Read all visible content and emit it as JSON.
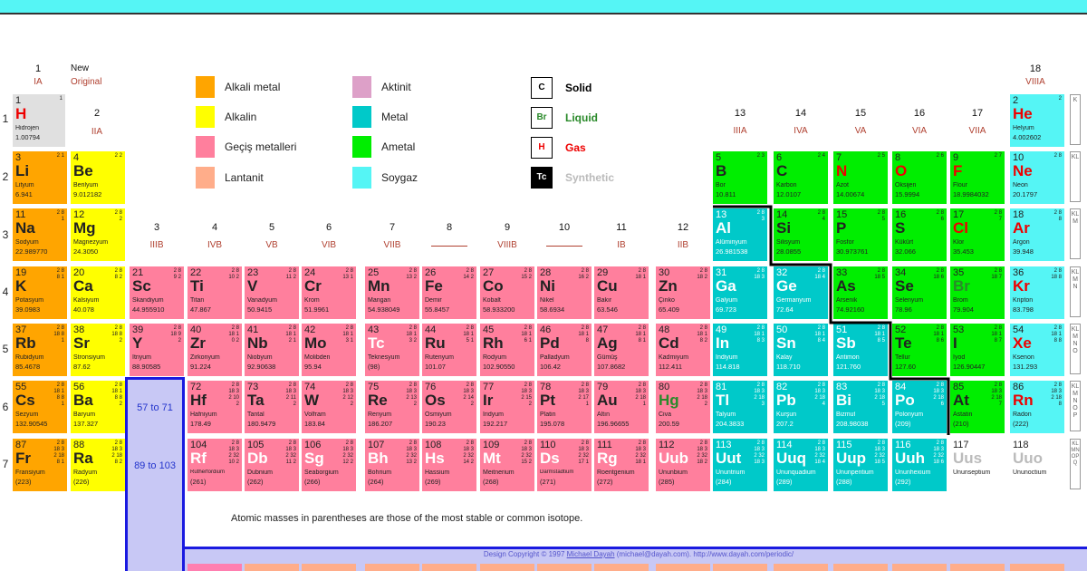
{
  "colors": {
    "alkali": "#ffa500",
    "alkaline": "#ffff00",
    "transition": "#ff7f9d",
    "lanthanide": "#ffad8a",
    "actinide": "#dda0c8",
    "metal": "#00c9c9",
    "nonmetal": "#00ee00",
    "noble": "#55f5f5",
    "unknown": "#ffffff",
    "hydrogen": "#e0e0e0"
  },
  "header": {
    "g1": "1",
    "ia": "IA",
    "new": "New",
    "original": "Original",
    "g2": "2",
    "iia": "IIA",
    "g18": "18",
    "viiia": "VIIIA"
  },
  "groups": [
    {
      "num": "3",
      "rom": "IIIB"
    },
    {
      "num": "4",
      "rom": "IVB"
    },
    {
      "num": "5",
      "rom": "VB"
    },
    {
      "num": "6",
      "rom": "VIB"
    },
    {
      "num": "7",
      "rom": "VIIB"
    },
    {
      "num": "8",
      "rom": ""
    },
    {
      "num": "9",
      "rom": "VIIIB"
    },
    {
      "num": "10",
      "rom": ""
    },
    {
      "num": "11",
      "rom": "IB"
    },
    {
      "num": "12",
      "rom": "IIB"
    },
    {
      "num": "13",
      "rom": "IIIA"
    },
    {
      "num": "14",
      "rom": "IVA"
    },
    {
      "num": "15",
      "rom": "VA"
    },
    {
      "num": "16",
      "rom": "VIA"
    },
    {
      "num": "17",
      "rom": "VIIA"
    }
  ],
  "legend": {
    "alkali": "Alkali metal",
    "alkaline": "Alkalin",
    "transition": "Geçiş metalleri",
    "lanthanide": "Lantanit",
    "actinide": "Aktinit",
    "metal": "Metal",
    "nonmetal": "Ametal",
    "noble": "Soygaz"
  },
  "states": {
    "solid_box": "C",
    "solid": "Solid",
    "liquid_box": "Br",
    "liquid": "Liquid",
    "gas_box": "H",
    "gas": "Gas",
    "syn_box": "Tc",
    "syn": "Synthetic"
  },
  "rows": [
    "1",
    "2",
    "3",
    "4",
    "5",
    "6",
    "7"
  ],
  "shells": [
    "K",
    "KL",
    "KLM",
    "KLMN",
    "KLMNO",
    "KLMNOP",
    "KLMNOPQ"
  ],
  "placeholders": {
    "lan": "57 to 71",
    "act": "89 to 103"
  },
  "footnote": "Atomic masses in parentheses are those of the most stable or common isotope.",
  "copyright_pre": "Design Copyright © 1997 ",
  "copyright_name": "Michael Dayah",
  "copyright_post": " (michael@dayah.com). http://www.dayah.com/periodic/",
  "elements": [
    {
      "z": "1",
      "s": "H",
      "n": "Hidrojen",
      "m": "1.00794",
      "sh": "1",
      "c": "hydrogen",
      "col": 1,
      "row": 1,
      "st": "gas"
    },
    {
      "z": "2",
      "s": "He",
      "n": "Helyum",
      "m": "4.002602",
      "sh": "2",
      "c": "noble",
      "col": 18,
      "row": 1,
      "st": "gas"
    },
    {
      "z": "3",
      "s": "Li",
      "n": "Lityum",
      "m": "6.941",
      "sh": "2 1",
      "c": "alkali",
      "col": 1,
      "row": 2
    },
    {
      "z": "4",
      "s": "Be",
      "n": "Berilyum",
      "m": "9.012182",
      "sh": "2 2",
      "c": "alkaline",
      "col": 2,
      "row": 2
    },
    {
      "z": "5",
      "s": "B",
      "n": "Bor",
      "m": "10.811",
      "sh": "2 3",
      "c": "nonmetal",
      "col": 13,
      "row": 2
    },
    {
      "z": "6",
      "s": "C",
      "n": "Karbon",
      "m": "12.0107",
      "sh": "2 4",
      "c": "nonmetal",
      "col": 14,
      "row": 2
    },
    {
      "z": "7",
      "s": "N",
      "n": "Azot",
      "m": "14.00674",
      "sh": "2 5",
      "c": "nonmetal",
      "col": 15,
      "row": 2,
      "st": "gas"
    },
    {
      "z": "8",
      "s": "O",
      "n": "Oksijen",
      "m": "15.9994",
      "sh": "2 6",
      "c": "nonmetal",
      "col": 16,
      "row": 2,
      "st": "gas"
    },
    {
      "z": "9",
      "s": "F",
      "n": "Flour",
      "m": "18.9984032",
      "sh": "2 7",
      "c": "nonmetal",
      "col": 17,
      "row": 2,
      "st": "gas"
    },
    {
      "z": "10",
      "s": "Ne",
      "n": "Neon",
      "m": "20.1797",
      "sh": "2 8",
      "c": "noble",
      "col": 18,
      "row": 2,
      "st": "gas"
    },
    {
      "z": "11",
      "s": "Na",
      "n": "Sodyum",
      "m": "22.989770",
      "sh": "2 8 1",
      "c": "alkali",
      "col": 1,
      "row": 3
    },
    {
      "z": "12",
      "s": "Mg",
      "n": "Magnezyum",
      "m": "24.3050",
      "sh": "2 8 2",
      "c": "alkaline",
      "col": 2,
      "row": 3
    },
    {
      "z": "13",
      "s": "Al",
      "n": "Alüminyum",
      "m": "26.981538",
      "sh": "2 8 3",
      "c": "metal",
      "col": 13,
      "row": 3
    },
    {
      "z": "14",
      "s": "Si",
      "n": "Silisyum",
      "m": "28.0855",
      "sh": "2 8 4",
      "c": "nonmetal",
      "col": 14,
      "row": 3
    },
    {
      "z": "15",
      "s": "P",
      "n": "Fosfor",
      "m": "30.973761",
      "sh": "2 8 5",
      "c": "nonmetal",
      "col": 15,
      "row": 3
    },
    {
      "z": "16",
      "s": "S",
      "n": "Kükürt",
      "m": "32.066",
      "sh": "2 8 6",
      "c": "nonmetal",
      "col": 16,
      "row": 3
    },
    {
      "z": "17",
      "s": "Cl",
      "n": "Klor",
      "m": "35.453",
      "sh": "2 8 7",
      "c": "nonmetal",
      "col": 17,
      "row": 3,
      "st": "gas"
    },
    {
      "z": "18",
      "s": "Ar",
      "n": "Argon",
      "m": "39.948",
      "sh": "2 8 8",
      "c": "noble",
      "col": 18,
      "row": 3,
      "st": "gas"
    },
    {
      "z": "19",
      "s": "K",
      "n": "Potasyum",
      "m": "39.0983",
      "sh": "2 8 8 1",
      "c": "alkali",
      "col": 1,
      "row": 4
    },
    {
      "z": "20",
      "s": "Ca",
      "n": "Kalsiyum",
      "m": "40.078",
      "sh": "2 8 8 2",
      "c": "alkaline",
      "col": 2,
      "row": 4
    },
    {
      "z": "21",
      "s": "Sc",
      "n": "Skandiyum",
      "m": "44.955910",
      "sh": "2 8 9 2",
      "c": "transition",
      "col": 3,
      "row": 4
    },
    {
      "z": "22",
      "s": "Ti",
      "n": "Titan",
      "m": "47.867",
      "sh": "2 8 10 2",
      "c": "transition",
      "col": 4,
      "row": 4
    },
    {
      "z": "23",
      "s": "V",
      "n": "Vanadyum",
      "m": "50.9415",
      "sh": "2 8 11 2",
      "c": "transition",
      "col": 5,
      "row": 4
    },
    {
      "z": "24",
      "s": "Cr",
      "n": "Krom",
      "m": "51.9961",
      "sh": "2 8 13 1",
      "c": "transition",
      "col": 6,
      "row": 4
    },
    {
      "z": "25",
      "s": "Mn",
      "n": "Mangan",
      "m": "54.938049",
      "sh": "2 8 13 2",
      "c": "transition",
      "col": 7,
      "row": 4
    },
    {
      "z": "26",
      "s": "Fe",
      "n": "Demir",
      "m": "55.8457",
      "sh": "2 8 14 2",
      "c": "transition",
      "col": 8,
      "row": 4
    },
    {
      "z": "27",
      "s": "Co",
      "n": "Kobalt",
      "m": "58.933200",
      "sh": "2 8 15 2",
      "c": "transition",
      "col": 9,
      "row": 4
    },
    {
      "z": "28",
      "s": "Ni",
      "n": "Nikel",
      "m": "58.6934",
      "sh": "2 8 16 2",
      "c": "transition",
      "col": 10,
      "row": 4
    },
    {
      "z": "29",
      "s": "Cu",
      "n": "Bakır",
      "m": "63.546",
      "sh": "2 8 18 1",
      "c": "transition",
      "col": 11,
      "row": 4
    },
    {
      "z": "30",
      "s": "Zn",
      "n": "Çinko",
      "m": "65.409",
      "sh": "2 8 18 2",
      "c": "transition",
      "col": 12,
      "row": 4
    },
    {
      "z": "31",
      "s": "Ga",
      "n": "Galyum",
      "m": "69.723",
      "sh": "2 8 18 3",
      "c": "metal",
      "col": 13,
      "row": 4
    },
    {
      "z": "32",
      "s": "Ge",
      "n": "Germanyum",
      "m": "72.64",
      "sh": "2 8 18 4",
      "c": "metal",
      "col": 14,
      "row": 4
    },
    {
      "z": "33",
      "s": "As",
      "n": "Arsenik",
      "m": "74.92160",
      "sh": "2 8 18 5",
      "c": "nonmetal",
      "col": 15,
      "row": 4
    },
    {
      "z": "34",
      "s": "Se",
      "n": "Selenyum",
      "m": "78.96",
      "sh": "2 8 18 6",
      "c": "nonmetal",
      "col": 16,
      "row": 4
    },
    {
      "z": "35",
      "s": "Br",
      "n": "Brom",
      "m": "79.904",
      "sh": "2 8 18 7",
      "c": "nonmetal",
      "col": 17,
      "row": 4,
      "st": "liquid"
    },
    {
      "z": "36",
      "s": "Kr",
      "n": "Kripton",
      "m": "83.798",
      "sh": "2 8 18 8",
      "c": "noble",
      "col": 18,
      "row": 4,
      "st": "gas"
    },
    {
      "z": "37",
      "s": "Rb",
      "n": "Rubidyum",
      "m": "85.4678",
      "sh": "2 8 18 8 1",
      "c": "alkali",
      "col": 1,
      "row": 5
    },
    {
      "z": "38",
      "s": "Sr",
      "n": "Stronsiyum",
      "m": "87.62",
      "sh": "2 8 18 8 2",
      "c": "alkaline",
      "col": 2,
      "row": 5
    },
    {
      "z": "39",
      "s": "Y",
      "n": "İtriyum",
      "m": "88.90585",
      "sh": "2 8 18 9 2",
      "c": "transition",
      "col": 3,
      "row": 5
    },
    {
      "z": "40",
      "s": "Zr",
      "n": "Zirkonyum",
      "m": "91.224",
      "sh": "2 8 18 10 2",
      "c": "transition",
      "col": 4,
      "row": 5
    },
    {
      "z": "41",
      "s": "Nb",
      "n": "Niobyum",
      "m": "92.90638",
      "sh": "2 8 18 12 1",
      "c": "transition",
      "col": 5,
      "row": 5
    },
    {
      "z": "42",
      "s": "Mo",
      "n": "Molibden",
      "m": "95.94",
      "sh": "2 8 18 13 1",
      "c": "transition",
      "col": 6,
      "row": 5
    },
    {
      "z": "43",
      "s": "Tc",
      "n": "Teknesyum",
      "m": "(98)",
      "sh": "2 8 18 13 2",
      "c": "transition",
      "col": 7,
      "row": 5,
      "st": "syn"
    },
    {
      "z": "44",
      "s": "Ru",
      "n": "Rutenyum",
      "m": "101.07",
      "sh": "2 8 18 15 1",
      "c": "transition",
      "col": 8,
      "row": 5
    },
    {
      "z": "45",
      "s": "Rh",
      "n": "Rodyum",
      "m": "102.90550",
      "sh": "2 8 18 16 1",
      "c": "transition",
      "col": 9,
      "row": 5
    },
    {
      "z": "46",
      "s": "Pd",
      "n": "Palladyum",
      "m": "106.42",
      "sh": "2 8 18 18",
      "c": "transition",
      "col": 10,
      "row": 5
    },
    {
      "z": "47",
      "s": "Ag",
      "n": "Gümüş",
      "m": "107.8682",
      "sh": "2 8 18 18 1",
      "c": "transition",
      "col": 11,
      "row": 5
    },
    {
      "z": "48",
      "s": "Cd",
      "n": "Kadmiyum",
      "m": "112.411",
      "sh": "2 8 18 18 2",
      "c": "transition",
      "col": 12,
      "row": 5
    },
    {
      "z": "49",
      "s": "In",
      "n": "İndiyum",
      "m": "114.818",
      "sh": "2 8 18 18 3",
      "c": "metal",
      "col": 13,
      "row": 5
    },
    {
      "z": "50",
      "s": "Sn",
      "n": "Kalay",
      "m": "118.710",
      "sh": "2 8 18 18 4",
      "c": "metal",
      "col": 14,
      "row": 5
    },
    {
      "z": "51",
      "s": "Sb",
      "n": "Antimon",
      "m": "121.760",
      "sh": "2 8 18 18 5",
      "c": "metal",
      "col": 15,
      "row": 5
    },
    {
      "z": "52",
      "s": "Te",
      "n": "Tellur",
      "m": "127.60",
      "sh": "2 8 18 18 6",
      "c": "nonmetal",
      "col": 16,
      "row": 5
    },
    {
      "z": "53",
      "s": "I",
      "n": "İyod",
      "m": "126.90447",
      "sh": "2 8 18 18 7",
      "c": "nonmetal",
      "col": 17,
      "row": 5
    },
    {
      "z": "54",
      "s": "Xe",
      "n": "Ksenon",
      "m": "131.293",
      "sh": "2 8 18 18 8",
      "c": "noble",
      "col": 18,
      "row": 5,
      "st": "gas"
    },
    {
      "z": "55",
      "s": "Cs",
      "n": "Sezyum",
      "m": "132.90545",
      "sh": "2 8 18 18 8 1",
      "c": "alkali",
      "col": 1,
      "row": 6
    },
    {
      "z": "56",
      "s": "Ba",
      "n": "Baryum",
      "m": "137.327",
      "sh": "2 8 18 18 8 2",
      "c": "alkaline",
      "col": 2,
      "row": 6
    },
    {
      "z": "72",
      "s": "Hf",
      "n": "Hafniyum",
      "m": "178.49",
      "sh": "2 8 18 32 10 2",
      "c": "transition",
      "col": 4,
      "row": 6
    },
    {
      "z": "73",
      "s": "Ta",
      "n": "Tantal",
      "m": "180.9479",
      "sh": "2 8 18 32 11 2",
      "c": "transition",
      "col": 5,
      "row": 6
    },
    {
      "z": "74",
      "s": "W",
      "n": "Volfram",
      "m": "183.84",
      "sh": "2 8 18 32 12 2",
      "c": "transition",
      "col": 6,
      "row": 6
    },
    {
      "z": "75",
      "s": "Re",
      "n": "Renyum",
      "m": "186.207",
      "sh": "2 8 18 32 13 2",
      "c": "transition",
      "col": 7,
      "row": 6
    },
    {
      "z": "76",
      "s": "Os",
      "n": "Osmiyum",
      "m": "190.23",
      "sh": "2 8 18 32 14 2",
      "c": "transition",
      "col": 8,
      "row": 6
    },
    {
      "z": "77",
      "s": "Ir",
      "n": "İridyum",
      "m": "192.217",
      "sh": "2 8 18 32 15 2",
      "c": "transition",
      "col": 9,
      "row": 6
    },
    {
      "z": "78",
      "s": "Pt",
      "n": "Platin",
      "m": "195.078",
      "sh": "2 8 18 32 17 1",
      "c": "transition",
      "col": 10,
      "row": 6
    },
    {
      "z": "79",
      "s": "Au",
      "n": "Altın",
      "m": "196.96655",
      "sh": "2 8 18 32 18 1",
      "c": "transition",
      "col": 11,
      "row": 6
    },
    {
      "z": "80",
      "s": "Hg",
      "n": "Civa",
      "m": "200.59",
      "sh": "2 8 18 32 18 2",
      "c": "transition",
      "col": 12,
      "row": 6,
      "st": "liquid"
    },
    {
      "z": "81",
      "s": "Tl",
      "n": "Talyum",
      "m": "204.3833",
      "sh": "2 8 18 32 18 3",
      "c": "metal",
      "col": 13,
      "row": 6
    },
    {
      "z": "82",
      "s": "Pb",
      "n": "Kurşun",
      "m": "207.2",
      "sh": "2 8 18 32 18 4",
      "c": "metal",
      "col": 14,
      "row": 6
    },
    {
      "z": "83",
      "s": "Bi",
      "n": "Bizmut",
      "m": "208.98038",
      "sh": "2 8 18 32 18 5",
      "c": "metal",
      "col": 15,
      "row": 6
    },
    {
      "z": "84",
      "s": "Po",
      "n": "Polonyum",
      "m": "(209)",
      "sh": "2 8 18 32 18 6",
      "c": "metal",
      "col": 16,
      "row": 6
    },
    {
      "z": "85",
      "s": "At",
      "n": "Astatin",
      "m": "(210)",
      "sh": "2 8 18 32 18 7",
      "c": "nonmetal",
      "col": 17,
      "row": 6
    },
    {
      "z": "86",
      "s": "Rn",
      "n": "Radon",
      "m": "(222)",
      "sh": "2 8 18 32 18 8",
      "c": "noble",
      "col": 18,
      "row": 6,
      "st": "gas"
    },
    {
      "z": "87",
      "s": "Fr",
      "n": "Fransiyum",
      "m": "(223)",
      "sh": "2 8 18 32 18 8 1",
      "c": "alkali",
      "col": 1,
      "row": 7
    },
    {
      "z": "88",
      "s": "Ra",
      "n": "Radyum",
      "m": "(226)",
      "sh": "2 8 18 32 18 8 2",
      "c": "alkaline",
      "col": 2,
      "row": 7
    },
    {
      "z": "104",
      "s": "Rf",
      "n": "Rutherfordium",
      "m": "(261)",
      "sh": "2 8 18 32 32 10 2",
      "c": "transition",
      "col": 4,
      "row": 7,
      "st": "syn"
    },
    {
      "z": "105",
      "s": "Db",
      "n": "Dubnium",
      "m": "(262)",
      "sh": "2 8 18 32 32 11 2",
      "c": "transition",
      "col": 5,
      "row": 7,
      "st": "syn"
    },
    {
      "z": "106",
      "s": "Sg",
      "n": "Seaborgium",
      "m": "(266)",
      "sh": "2 8 18 32 32 12 2",
      "c": "transition",
      "col": 6,
      "row": 7,
      "st": "syn"
    },
    {
      "z": "107",
      "s": "Bh",
      "n": "Bohrium",
      "m": "(264)",
      "sh": "2 8 18 32 32 13 2",
      "c": "transition",
      "col": 7,
      "row": 7,
      "st": "syn"
    },
    {
      "z": "108",
      "s": "Hs",
      "n": "Hassium",
      "m": "(269)",
      "sh": "2 8 18 32 32 14 2",
      "c": "transition",
      "col": 8,
      "row": 7,
      "st": "syn"
    },
    {
      "z": "109",
      "s": "Mt",
      "n": "Meitnerium",
      "m": "(268)",
      "sh": "2 8 18 32 32 15 2",
      "c": "transition",
      "col": 9,
      "row": 7,
      "st": "syn"
    },
    {
      "z": "110",
      "s": "Ds",
      "n": "Darmstadtium",
      "m": "(271)",
      "sh": "2 8 18 32 32 17 1",
      "c": "transition",
      "col": 10,
      "row": 7,
      "st": "syn"
    },
    {
      "z": "111",
      "s": "Rg",
      "n": "Roentgenium",
      "m": "(272)",
      "sh": "2 8 18 32 32 18 1",
      "c": "transition",
      "col": 11,
      "row": 7,
      "st": "syn"
    },
    {
      "z": "112",
      "s": "Uub",
      "n": "Ununbium",
      "m": "(285)",
      "sh": "2 8 18 32 32 18 2",
      "c": "transition",
      "col": 12,
      "row": 7,
      "st": "syn"
    },
    {
      "z": "113",
      "s": "Uut",
      "n": "Ununtrium",
      "m": "(284)",
      "sh": "2 8 18 32 32 18 3",
      "c": "metal",
      "col": 13,
      "row": 7,
      "st": "syn"
    },
    {
      "z": "114",
      "s": "Uuq",
      "n": "Ununquadium",
      "m": "(289)",
      "sh": "2 8 18 32 32 18 4",
      "c": "metal",
      "col": 14,
      "row": 7,
      "st": "syn"
    },
    {
      "z": "115",
      "s": "Uup",
      "n": "Ununpentium",
      "m": "(288)",
      "sh": "2 8 18 32 32 18 5",
      "c": "metal",
      "col": 15,
      "row": 7,
      "st": "syn"
    },
    {
      "z": "116",
      "s": "Uuh",
      "n": "Ununhexium",
      "m": "(292)",
      "sh": "2 8 18 32 32 18 6",
      "c": "metal",
      "col": 16,
      "row": 7,
      "st": "syn"
    },
    {
      "z": "117",
      "s": "Uus",
      "n": "Ununseptium",
      "m": "",
      "sh": "",
      "c": "unknown",
      "col": 17,
      "row": 7,
      "st": "unk"
    },
    {
      "z": "118",
      "s": "Uuo",
      "n": "Ununoctium",
      "m": "",
      "sh": "",
      "c": "unknown",
      "col": 18,
      "row": 7,
      "st": "unk"
    }
  ]
}
